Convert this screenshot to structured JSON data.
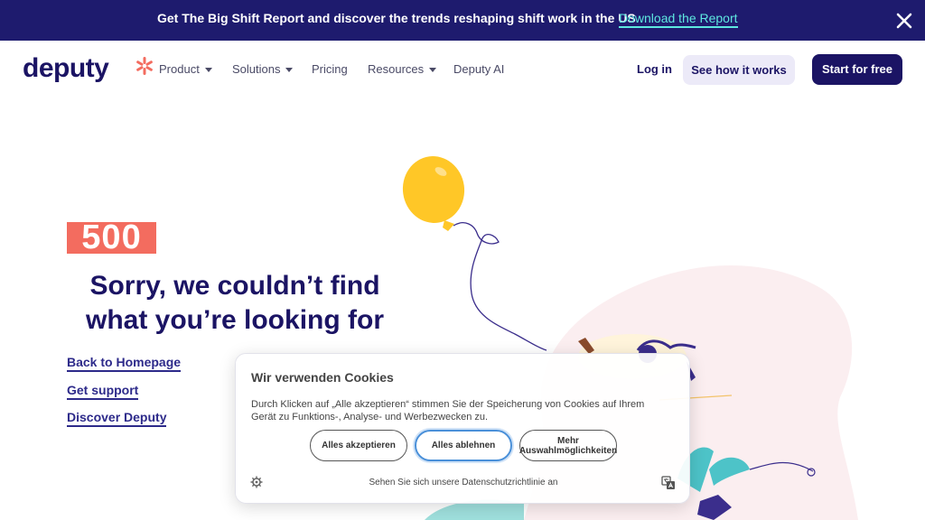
{
  "announcement": {
    "text": "Get The Big Shift Report and discover the trends reshaping shift work in the US",
    "link_label": "Download the Report",
    "close_icon": "close-icon"
  },
  "nav": {
    "logo_text": "deputy",
    "items": [
      {
        "label": "Product",
        "has_dropdown": true
      },
      {
        "label": "Solutions",
        "has_dropdown": true
      },
      {
        "label": "Pricing",
        "has_dropdown": false
      },
      {
        "label": "Resources",
        "has_dropdown": true
      },
      {
        "label": "Deputy AI",
        "has_dropdown": false
      }
    ],
    "login_label": "Log in",
    "demo_label": "See how it works",
    "start_label": "Start for free"
  },
  "hero": {
    "code": "500",
    "headline_line1": "Sorry, we couldn’t find",
    "headline_line2": "what you’re looking for",
    "links": [
      "Back to Homepage",
      "Get support",
      "Discover Deputy"
    ]
  },
  "cookie": {
    "title": "Wir verwenden Cookies",
    "body": "Durch Klicken auf „Alle akzeptieren“ stimmen Sie der Speicherung von Cookies auf Ihrem Gerät zu Funktions-, Analyse- und Werbezwecken zu.",
    "accept_label": "Alles akzeptieren",
    "reject_label": "Alles ablehnen",
    "more_label_line1": "Mehr",
    "more_label_line2": "Auswahlmöglichkeiten",
    "policy_label": "Sehen Sie sich unsere Datenschutzrichtlinie an"
  },
  "colors": {
    "brand_navy": "#1b1464",
    "announce_bg": "#1e1b6e",
    "link_teal": "#5ee8e0",
    "error_coral": "#f36c5f",
    "balloon_yellow": "#ffc727"
  }
}
